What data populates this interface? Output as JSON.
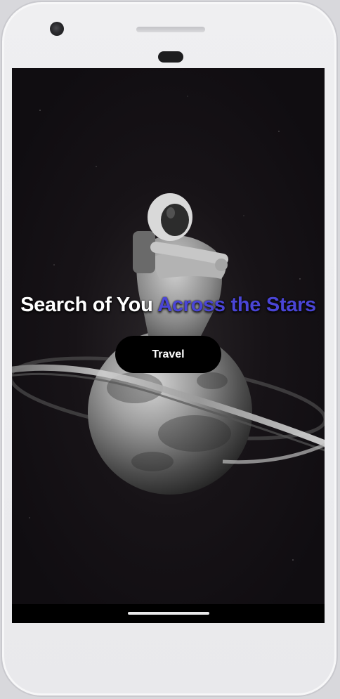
{
  "hero": {
    "title_white": "Search of You",
    "title_accent": "Across the Stars",
    "button_label": "Travel"
  },
  "colors": {
    "screen_background": "#110e12",
    "accent": "#4a45d6",
    "button_background": "#000000",
    "button_text": "#ffffff",
    "device_body": "#efeff1"
  },
  "icons": {
    "hero_art": "astronaut-on-ringed-planet"
  }
}
